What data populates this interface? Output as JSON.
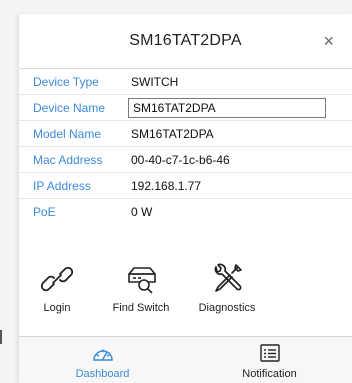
{
  "header": {
    "title": "SM16TAT2DPA",
    "close_glyph": "×"
  },
  "details": [
    {
      "label": "Device Type",
      "value": "SWITCH"
    },
    {
      "label": "Device Name",
      "value": "SM16TAT2DPA"
    },
    {
      "label": "Model Name",
      "value": "SM16TAT2DPA"
    },
    {
      "label": "Mac Address",
      "value": "00-40-c7-1c-b6-46"
    },
    {
      "label": "IP Address",
      "value": "192.168.1.77"
    },
    {
      "label": "PoE",
      "value": "0 W"
    }
  ],
  "actions": [
    {
      "label": "Login",
      "icon": "link-icon"
    },
    {
      "label": "Find Switch",
      "icon": "find-switch-icon"
    },
    {
      "label": "Diagnostics",
      "icon": "tools-icon"
    }
  ],
  "tabs": [
    {
      "label": "Dashboard",
      "icon": "gauge-icon",
      "active": true
    },
    {
      "label": "Notification",
      "icon": "list-icon",
      "active": false
    }
  ],
  "colors": {
    "accent": "#3c8bd9",
    "text": "#111111",
    "divider": "#e6e6e6"
  }
}
